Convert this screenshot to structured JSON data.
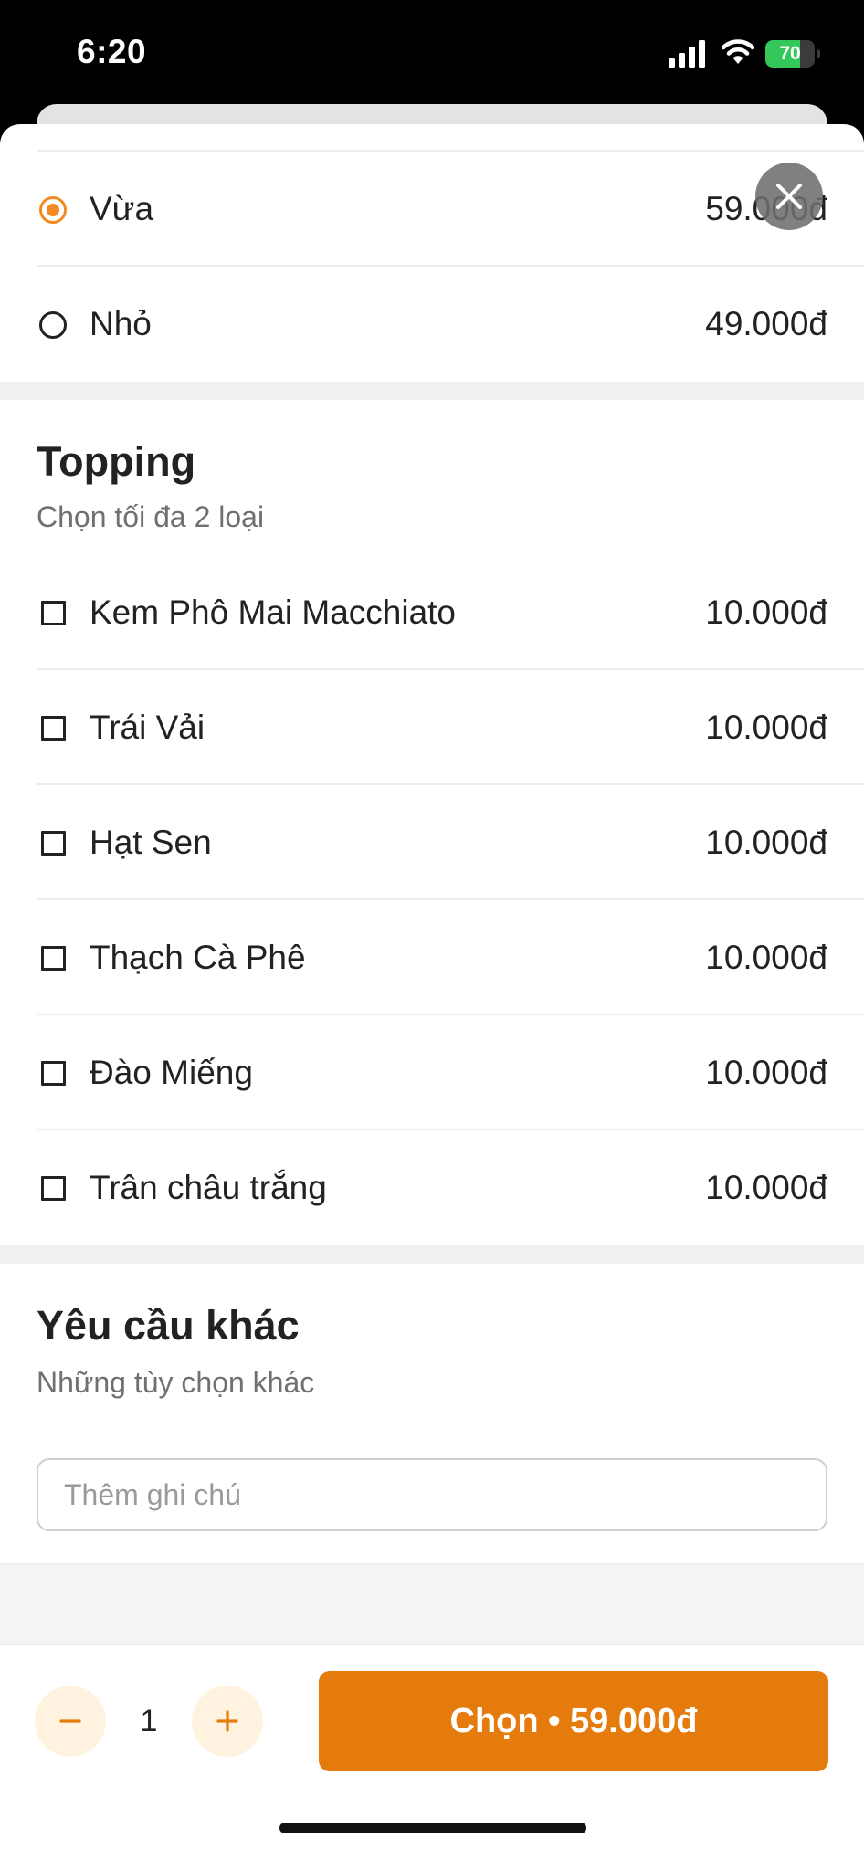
{
  "status_bar": {
    "time": "6:20",
    "battery_text": "70",
    "battery_level": 0.7,
    "icons": [
      "signal-icon",
      "wifi-icon",
      "battery-icon"
    ]
  },
  "colors": {
    "accent": "#e57b0c",
    "accent_light": "#fff3e0",
    "radio_selected": "#f28a1f",
    "battery_green": "#34c759"
  },
  "size_options": {
    "items": [
      {
        "label": "Vừa",
        "price": "59.000đ",
        "selected": true
      },
      {
        "label": "Nhỏ",
        "price": "49.000đ",
        "selected": false
      }
    ]
  },
  "topping": {
    "title": "Topping",
    "subtitle": "Chọn tối đa 2 loại",
    "items": [
      {
        "label": "Kem Phô Mai Macchiato",
        "price": "10.000đ",
        "checked": false
      },
      {
        "label": "Trái Vải",
        "price": "10.000đ",
        "checked": false
      },
      {
        "label": "Hạt Sen",
        "price": "10.000đ",
        "checked": false
      },
      {
        "label": "Thạch Cà Phê",
        "price": "10.000đ",
        "checked": false
      },
      {
        "label": "Đào Miếng",
        "price": "10.000đ",
        "checked": false
      },
      {
        "label": "Trân châu trắng",
        "price": "10.000đ",
        "checked": false
      }
    ]
  },
  "other_requests": {
    "title": "Yêu cầu khác",
    "subtitle": "Những tùy chọn khác",
    "note_placeholder": "Thêm ghi chú",
    "note_value": ""
  },
  "bottom_bar": {
    "quantity": "1",
    "choose_label": "Chọn • 59.000đ"
  }
}
